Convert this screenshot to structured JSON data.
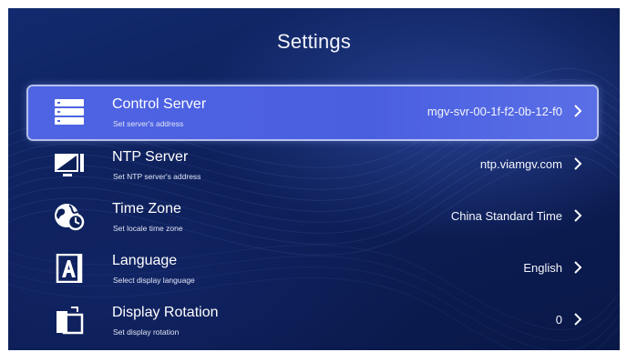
{
  "page": {
    "title": "Settings"
  },
  "settings": {
    "items": [
      {
        "label": "Control Server",
        "sublabel": "Set server's address",
        "value": "mgv-svr-00-1f-f2-0b-12-f0",
        "icon": "server-icon",
        "selected": true
      },
      {
        "label": "NTP Server",
        "sublabel": "Set NTP server's address",
        "value": "ntp.viamgv.com",
        "icon": "monitor-icon",
        "selected": false
      },
      {
        "label": "Time Zone",
        "sublabel": "Set locale time zone",
        "value": "China Standard Time",
        "icon": "globe-clock-icon",
        "selected": false
      },
      {
        "label": "Language",
        "sublabel": "Select display language",
        "value": "English",
        "icon": "language-icon",
        "selected": false
      },
      {
        "label": "Display Rotation",
        "sublabel": "Set display rotation",
        "value": "0",
        "icon": "rotate-screen-icon",
        "selected": false
      }
    ]
  },
  "colors": {
    "background": "#0d1f57",
    "selected_row": "#4f64e3",
    "text": "#ffffff"
  }
}
